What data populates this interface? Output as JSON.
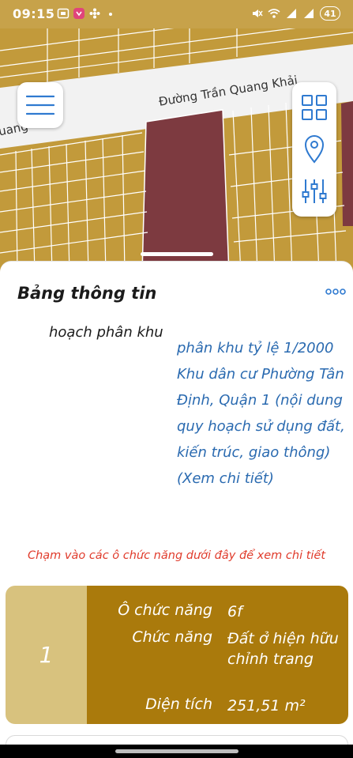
{
  "status_bar": {
    "time": "09:15",
    "battery": "41",
    "left_icons": [
      "screenshot-icon",
      "app-icon",
      "flower-icon",
      "dot-icon"
    ],
    "right_icons": [
      "mute-icon",
      "wifi-icon",
      "signal-icon",
      "signal-icon"
    ]
  },
  "map": {
    "street_name": "Đường Trần Quang Khải",
    "street_fragment": "uang",
    "colors": {
      "residential": "#c29a3b",
      "highlight_parcel": "#7d3a40",
      "road": "#f2f2f2",
      "lot_lines": "#ffffff"
    }
  },
  "sheet": {
    "title": "Bảng thông tin",
    "plan_label": "hoạch phân khu",
    "plan_link": "phân khu tỷ lệ 1/2000 Khu dân cư Phường Tân Định, Quận 1 (nội dung quy hoạch sử dụng đất, kiến trúc, giao thông) (Xem chi tiết)",
    "hint": "Chạm vào các ô chức năng dưới đây để xem chi tiết"
  },
  "card": {
    "index": "1",
    "rows": [
      {
        "key": "Ô chức năng",
        "value": "6f"
      },
      {
        "key": "Chức năng",
        "value": "Đất ở hiện hữu chỉnh trang"
      },
      {
        "key": "Diện tích",
        "value": "251,51 m²"
      }
    ],
    "colors": {
      "index_bg": "#d8c27e",
      "body_bg": "#aa7a0c"
    }
  }
}
